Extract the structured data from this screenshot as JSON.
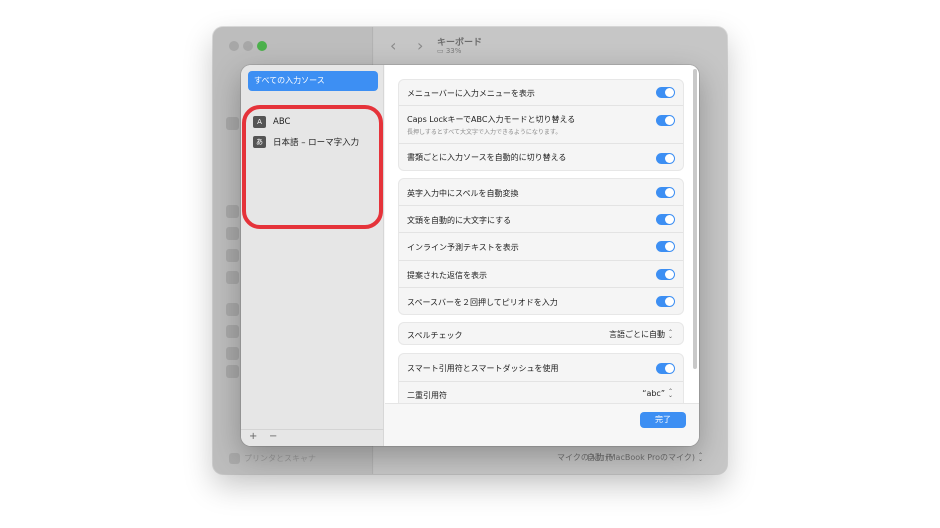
{
  "window": {
    "title": "キーボード",
    "subtitle": "33%",
    "bottom_item": "プリンタとスキャナ",
    "mic_label": "マイクの入力元",
    "mic_value": "自動 (MacBook Proのマイク)"
  },
  "sheet": {
    "sources_header": "すべての入力ソース",
    "sources": [
      {
        "badge": "A",
        "label": "ABC"
      },
      {
        "badge": "あ",
        "label": "日本語 – ローマ字入力"
      }
    ],
    "footer": {
      "add": "+",
      "remove": "−"
    },
    "group1": {
      "row1": "メニューバーに入力メニューを表示",
      "row2": "Caps LockキーでABC入力モードと切り替える",
      "row2_sub": "長押しするとすべて大文字で入力できるようになります。",
      "row3": "書類ごとに入力ソースを自動的に切り替える"
    },
    "group2": {
      "row1": "英字入力中にスペルを自動変換",
      "row2": "文頭を自動的に大文字にする",
      "row3": "インライン予測テキストを表示",
      "row4": "提案された返信を表示",
      "row5": "スペースバーを２回押してピリオドを入力"
    },
    "spellcheck": {
      "label": "スペルチェック",
      "value": "言語ごとに自動"
    },
    "group4": {
      "row1": "スマート引用符とスマートダッシュを使用",
      "row2": "二重引用符",
      "row2_value": "“abc”"
    },
    "done": "完了"
  },
  "colors": {
    "accent": "#3d8ff3",
    "highlight": "#e5333a"
  }
}
